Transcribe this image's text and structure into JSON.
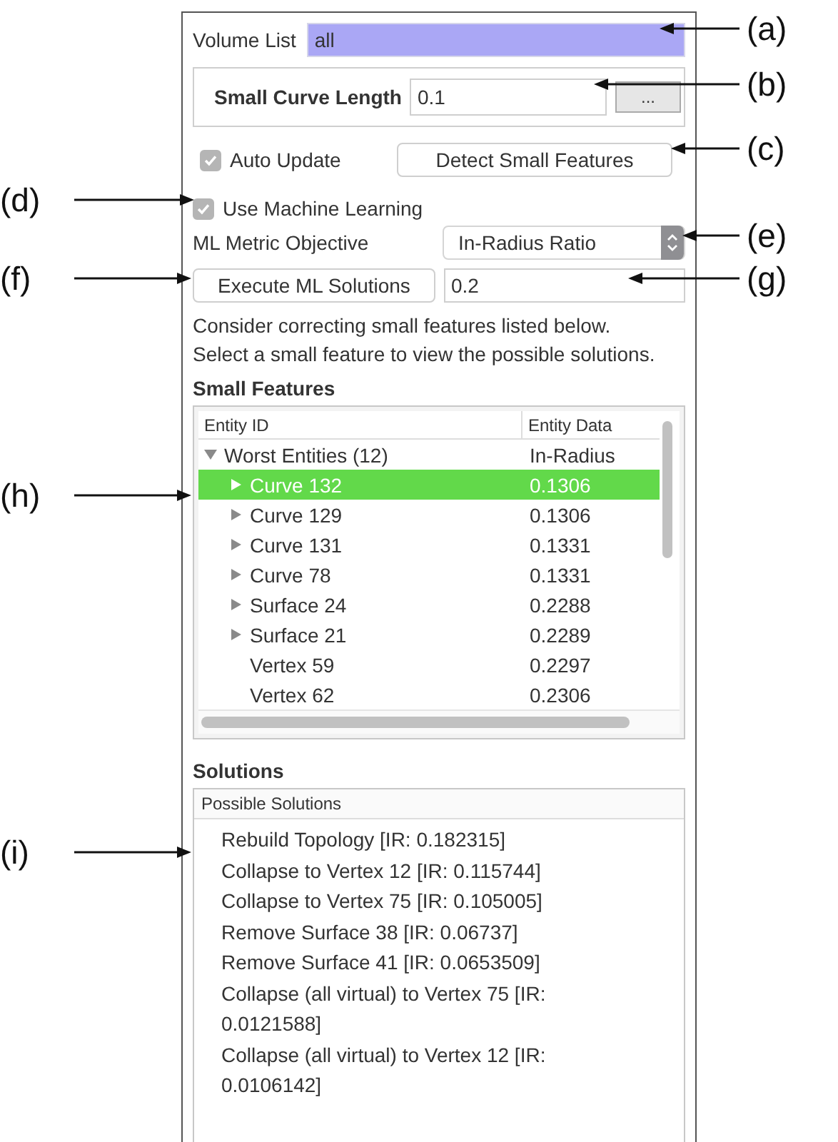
{
  "volume_list": {
    "label": "Volume List",
    "value": "all"
  },
  "small_curve_length": {
    "label": "Small Curve Length",
    "value": "0.1",
    "button": "..."
  },
  "auto_update": {
    "label": "Auto Update",
    "checked": true
  },
  "detect_button": "Detect Small Features",
  "use_ml": {
    "label": "Use Machine Learning",
    "checked": true
  },
  "ml_metric": {
    "label": "ML Metric Objective",
    "value": "In-Radius Ratio"
  },
  "execute_button": "Execute ML Solutions",
  "threshold": "0.2",
  "instructions": "Consider correcting small features listed below. Select a small feature to view the possible solutions.",
  "small_features": {
    "title": "Small Features",
    "columns": [
      "Entity ID",
      "Entity Data"
    ],
    "rows": [
      {
        "kind": "group",
        "id": "Worst Entities (12)",
        "data": "In-Radius",
        "expanded": true,
        "selected": false,
        "children": [
          {
            "kind": "branch",
            "id": "Curve 132",
            "data": "0.1306",
            "selected": true
          },
          {
            "kind": "branch",
            "id": "Curve 129",
            "data": "0.1306",
            "selected": false
          },
          {
            "kind": "branch",
            "id": "Curve 131",
            "data": "0.1331",
            "selected": false
          },
          {
            "kind": "branch",
            "id": "Curve 78",
            "data": "0.1331",
            "selected": false
          },
          {
            "kind": "branch",
            "id": "Surface 24",
            "data": "0.2288",
            "selected": false
          },
          {
            "kind": "branch",
            "id": "Surface 21",
            "data": "0.2289",
            "selected": false
          },
          {
            "kind": "leaf",
            "id": "Vertex 59",
            "data": "0.2297",
            "selected": false
          },
          {
            "kind": "leaf",
            "id": "Vertex 62",
            "data": "0.2306",
            "selected": false
          }
        ]
      }
    ]
  },
  "solutions": {
    "title": "Solutions",
    "header": "Possible Solutions",
    "items": [
      "Rebuild Topology [IR: 0.182315]",
      "Collapse to Vertex 12 [IR: 0.115744]",
      "Collapse to Vertex 75 [IR: 0.105005]",
      "Remove Surface 38 [IR: 0.06737]",
      "Remove Surface 41 [IR: 0.0653509]",
      "Collapse (all virtual) to Vertex 75 [IR: 0.0121588]",
      "Collapse (all virtual) to Vertex 12 [IR: 0.0106142]"
    ]
  },
  "annotations": [
    {
      "label": "(a)",
      "kind": "right"
    },
    {
      "label": "(b)",
      "kind": "right"
    },
    {
      "label": "(c)",
      "kind": "right"
    },
    {
      "label": "(d)",
      "kind": "left"
    },
    {
      "label": "(e)",
      "kind": "right"
    },
    {
      "label": "(f)",
      "kind": "left"
    },
    {
      "label": "(g)",
      "kind": "right"
    },
    {
      "label": "(h)",
      "kind": "left"
    },
    {
      "label": "(i)",
      "kind": "left"
    }
  ]
}
